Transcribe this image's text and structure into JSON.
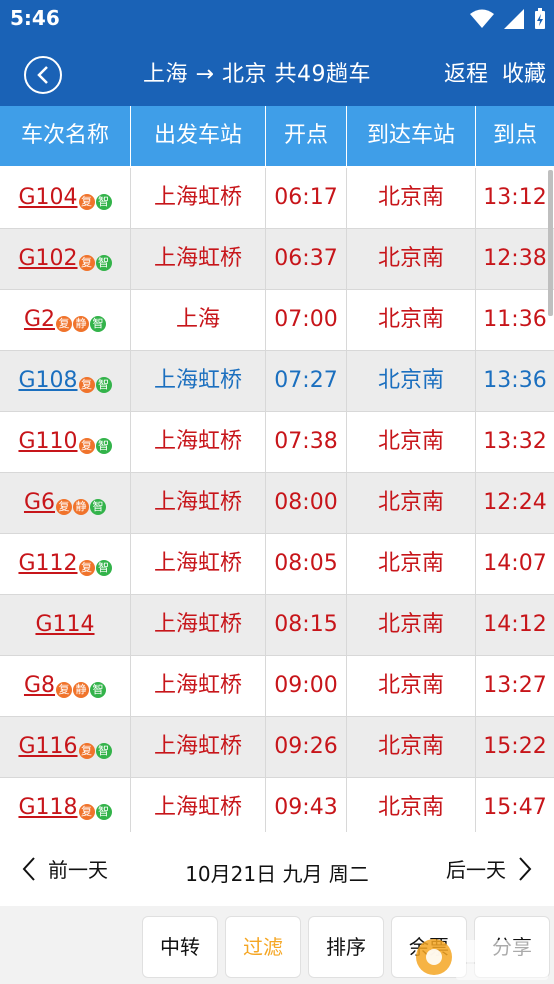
{
  "status_bar": {
    "time": "5:46"
  },
  "app_bar": {
    "title": "上海 → 北京 共49趟车",
    "return_label": "返程",
    "favorite_label": "收藏"
  },
  "table": {
    "headers": [
      "车次名称",
      "出发车站",
      "开点",
      "到达车站",
      "到点"
    ],
    "rows": [
      {
        "train": "G104",
        "badges": [
          "复",
          "智"
        ],
        "from": "上海虹桥",
        "depart": "06:17",
        "to": "北京南",
        "arrive": "13:12",
        "color": "red"
      },
      {
        "train": "G102",
        "badges": [
          "复",
          "智"
        ],
        "from": "上海虹桥",
        "depart": "06:37",
        "to": "北京南",
        "arrive": "12:38",
        "color": "red"
      },
      {
        "train": "G2",
        "badges": [
          "复",
          "静",
          "智"
        ],
        "from": "上海",
        "depart": "07:00",
        "to": "北京南",
        "arrive": "11:36",
        "color": "red"
      },
      {
        "train": "G108",
        "badges": [
          "复",
          "智"
        ],
        "from": "上海虹桥",
        "depart": "07:27",
        "to": "北京南",
        "arrive": "13:36",
        "color": "blue"
      },
      {
        "train": "G110",
        "badges": [
          "复",
          "智"
        ],
        "from": "上海虹桥",
        "depart": "07:38",
        "to": "北京南",
        "arrive": "13:32",
        "color": "red"
      },
      {
        "train": "G6",
        "badges": [
          "复",
          "静",
          "智"
        ],
        "from": "上海虹桥",
        "depart": "08:00",
        "to": "北京南",
        "arrive": "12:24",
        "color": "red"
      },
      {
        "train": "G112",
        "badges": [
          "复",
          "智"
        ],
        "from": "上海虹桥",
        "depart": "08:05",
        "to": "北京南",
        "arrive": "14:07",
        "color": "red"
      },
      {
        "train": "G114",
        "badges": [],
        "from": "上海虹桥",
        "depart": "08:15",
        "to": "北京南",
        "arrive": "14:12",
        "color": "red"
      },
      {
        "train": "G8",
        "badges": [
          "复",
          "静",
          "智"
        ],
        "from": "上海虹桥",
        "depart": "09:00",
        "to": "北京南",
        "arrive": "13:27",
        "color": "red"
      },
      {
        "train": "G116",
        "badges": [
          "复",
          "智"
        ],
        "from": "上海虹桥",
        "depart": "09:26",
        "to": "北京南",
        "arrive": "15:22",
        "color": "red"
      },
      {
        "train": "G118",
        "badges": [
          "复",
          "智"
        ],
        "from": "上海虹桥",
        "depart": "09:43",
        "to": "北京南",
        "arrive": "15:47",
        "color": "red"
      }
    ]
  },
  "day_nav": {
    "prev_label": "前一天",
    "date": "10月21日 九月 周二",
    "next_label": "后一天"
  },
  "toolbar": {
    "transfer_label": "中转",
    "filter_label": "过滤",
    "sort_label": "排序",
    "remaining_label": "余票",
    "stations_label": "分享"
  },
  "colors": {
    "primary": "#1a62b6",
    "header": "#3f9ee8",
    "train_red": "#c7151a",
    "train_blue": "#1b6fbf",
    "filter_accent": "#f5a623",
    "badge_orange": "#f0732b",
    "badge_green": "#33b34a"
  }
}
